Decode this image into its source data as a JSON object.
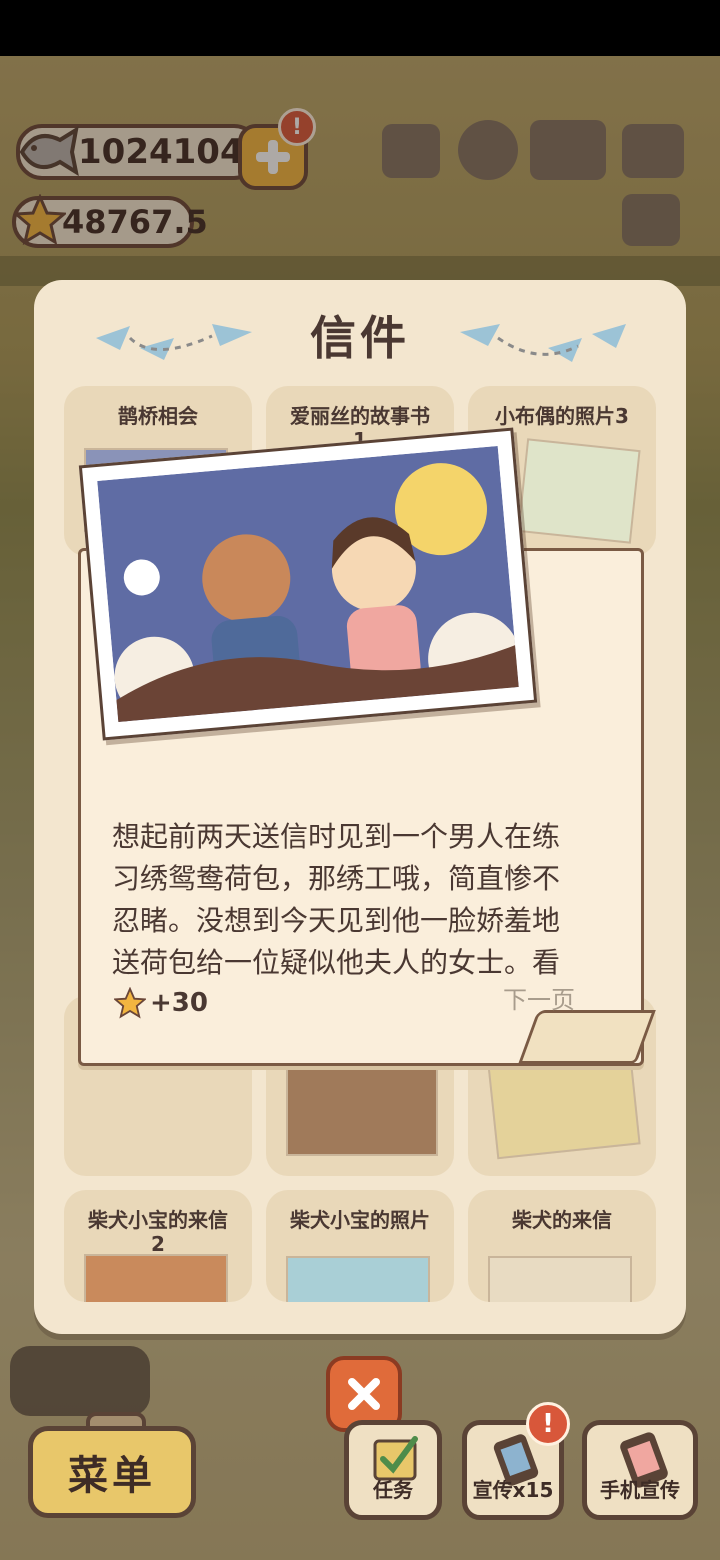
{
  "hud": {
    "fish_amount": "10241044",
    "star_amount": "48767.5",
    "plus_alert": "!"
  },
  "modal": {
    "title": "信件",
    "cards": [
      {
        "title": "鹊桥相会"
      },
      {
        "title": "爱丽丝的故事书\n1"
      },
      {
        "title": "小布偶的照片3"
      },
      {
        "title": "柴犬小宝的来信\n2"
      },
      {
        "title": "柴犬小宝的照片"
      },
      {
        "title": "柴犬的来信"
      }
    ]
  },
  "letter": {
    "text_lines": [
      "想起前两天送信时见到一个男人在练",
      "习绣鸳鸯荷包，那绣工哦，简直惨不",
      "忍睹。没想到今天见到他一脸娇羞地",
      "送荷包给一位疑似他夫人的女士。看"
    ],
    "reward": "+30",
    "next_page": "下一页"
  },
  "bottom": {
    "menu": "菜单",
    "task": "任务",
    "promo": "宣传x15",
    "promo_alert": "!",
    "phone_promo": "手机宣传"
  }
}
